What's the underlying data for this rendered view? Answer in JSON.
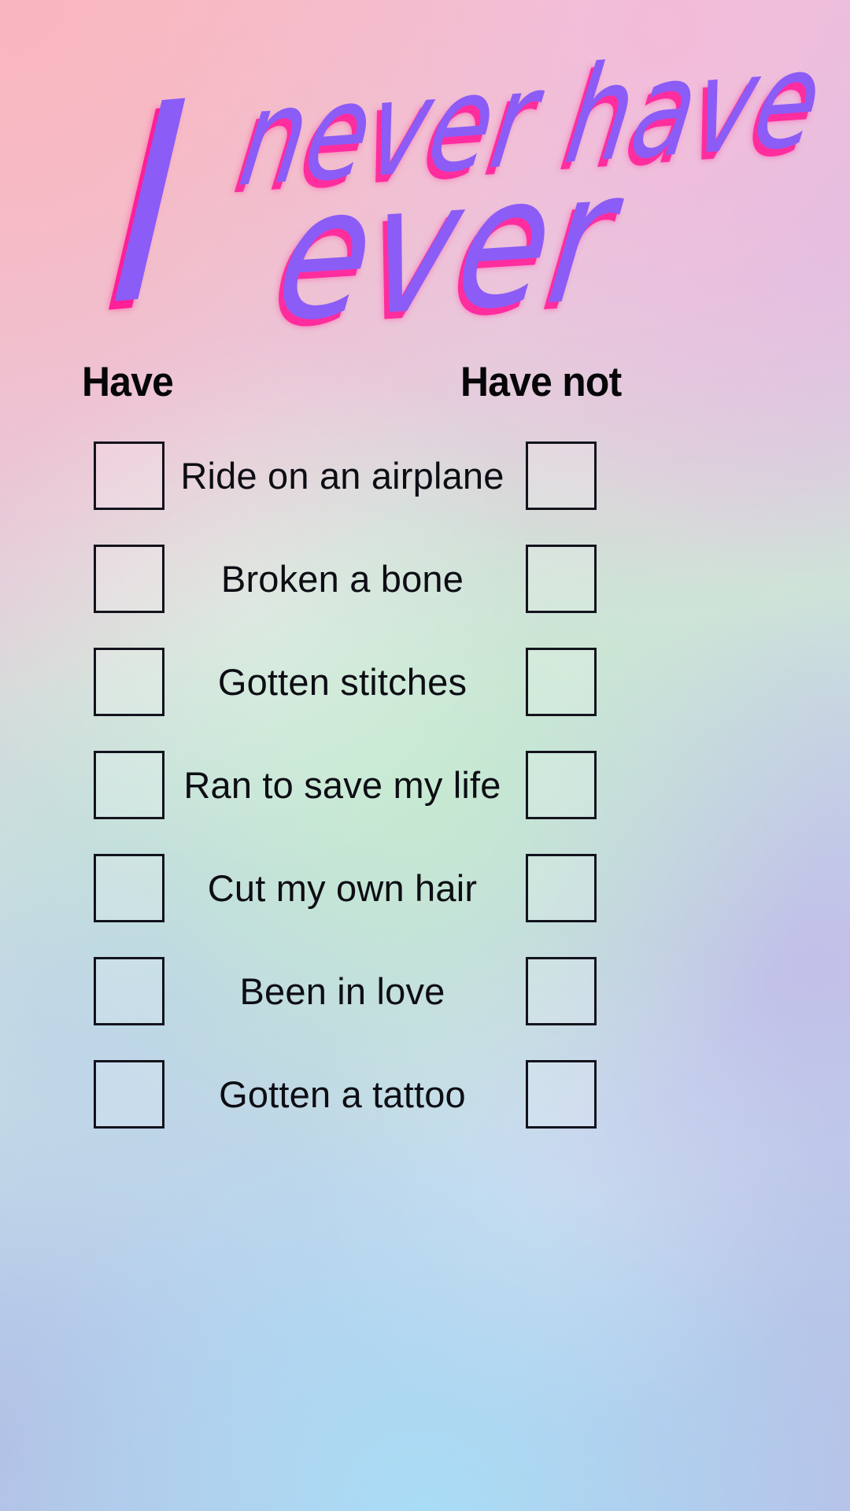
{
  "poster": {
    "title": {
      "full_text": "I never have ever",
      "big_initial": "I",
      "line1": "never have",
      "line2": "ever",
      "text_color": "#8b5cf6",
      "shadow_color": "#ff2d9e"
    },
    "columns": {
      "left_header": "Have",
      "right_header": "Have not"
    },
    "background": {
      "colors": [
        "#f9b6c0",
        "#f3bcd9",
        "#d9bfe8",
        "#c5e9d1",
        "#a9dcf5",
        "#b2c1e6"
      ]
    },
    "checkbox": {
      "border_color": "#13131d",
      "fill_color": "rgba(255,255,255,0.17)",
      "checked": false
    },
    "items": [
      {
        "label": "Ride on an airplane"
      },
      {
        "label": "Broken a bone"
      },
      {
        "label": "Gotten stitches"
      },
      {
        "label": "Ran to save my life"
      },
      {
        "label": "Cut my own hair"
      },
      {
        "label": "Been in love"
      },
      {
        "label": "Gotten a tattoo"
      }
    ]
  }
}
